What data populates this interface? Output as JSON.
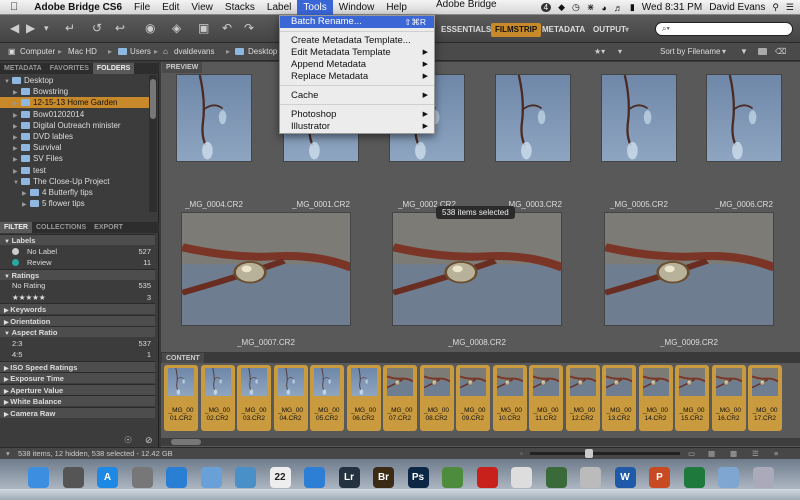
{
  "menubar": {
    "apple": "",
    "app_name": "Adobe Bridge CS6",
    "items": [
      "File",
      "Edit",
      "View",
      "Stacks",
      "Label",
      "Tools",
      "Window",
      "Help"
    ],
    "status_badge": "4",
    "clock": "Wed 8:31 PM",
    "user": "David Evans"
  },
  "toolbar": {
    "window_title_fragment": "Adobe Bridge",
    "workspaces": [
      "ESSENTIALS",
      "FILMSTRIP",
      "METADATA",
      "OUTPUT"
    ],
    "active_workspace": "FILMSTRIP",
    "search_placeholder": "⌕▾"
  },
  "pathbar": {
    "crumbs": [
      "Computer",
      "Mac HD",
      "Users",
      "dvaldevans",
      "Desktop"
    ],
    "sort_label": "Sort by Filename"
  },
  "tools_menu": {
    "items": [
      {
        "label": "Batch Rename...",
        "shortcut": "⇧⌘R",
        "submenu": false
      },
      {
        "label": "Create Metadata Template...",
        "shortcut": "",
        "submenu": false
      },
      {
        "label": "Edit Metadata Template",
        "shortcut": "",
        "submenu": true
      },
      {
        "label": "Append Metadata",
        "shortcut": "",
        "submenu": true
      },
      {
        "label": "Replace Metadata",
        "shortcut": "",
        "submenu": true
      },
      {
        "label": "Cache",
        "shortcut": "",
        "submenu": true
      },
      {
        "label": "Photoshop",
        "shortcut": "",
        "submenu": true
      },
      {
        "label": "Illustrator",
        "shortcut": "",
        "submenu": true
      }
    ]
  },
  "left_panel": {
    "top_tabs": [
      "METADATA",
      "FAVORITES",
      "FOLDERS"
    ],
    "active_top_tab": "FOLDERS",
    "folders": [
      {
        "label": "Desktop",
        "level": 0,
        "expanded": true,
        "selected": false
      },
      {
        "label": "Bowstring",
        "level": 1,
        "expanded": false,
        "selected": false
      },
      {
        "label": "12-15-13 Home Garden",
        "level": 1,
        "expanded": false,
        "selected": true
      },
      {
        "label": "Bow01202014",
        "level": 1,
        "expanded": false,
        "selected": false
      },
      {
        "label": "Digital Outreach minister",
        "level": 1,
        "expanded": false,
        "selected": false
      },
      {
        "label": "DVD lables",
        "level": 1,
        "expanded": false,
        "selected": false
      },
      {
        "label": "Survival",
        "level": 1,
        "expanded": false,
        "selected": false
      },
      {
        "label": "SV Files",
        "level": 1,
        "expanded": false,
        "selected": false
      },
      {
        "label": "test",
        "level": 1,
        "expanded": false,
        "selected": false
      },
      {
        "label": "The Close-Up Project",
        "level": 1,
        "expanded": true,
        "selected": false
      },
      {
        "label": "4 Butterfly tips",
        "level": 2,
        "expanded": false,
        "selected": false
      },
      {
        "label": "5 flower tips",
        "level": 2,
        "expanded": false,
        "selected": false
      }
    ],
    "bottom_tabs": [
      "FILTER",
      "COLLECTIONS",
      "EXPORT"
    ],
    "active_bottom_tab": "FILTER",
    "filter": [
      {
        "header": "Labels",
        "items": [
          {
            "label": "No Label",
            "count": "527"
          },
          {
            "label": "Review",
            "count": "11"
          }
        ]
      },
      {
        "header": "Ratings",
        "items": [
          {
            "label": "No Rating",
            "count": "535"
          },
          {
            "label": "★★★★★",
            "count": "3"
          }
        ]
      },
      {
        "header": "Keywords",
        "items": []
      },
      {
        "header": "Orientation",
        "items": []
      },
      {
        "header": "Aspect Ratio",
        "items": [
          {
            "label": "2:3",
            "count": "537"
          },
          {
            "label": "4:5",
            "count": "1"
          }
        ]
      },
      {
        "header": "ISO Speed Ratings",
        "items": []
      },
      {
        "header": "Exposure Time",
        "items": []
      },
      {
        "header": "Aperture Value",
        "items": []
      },
      {
        "header": "White Balance",
        "items": []
      },
      {
        "header": "Camera Raw",
        "items": []
      }
    ]
  },
  "preview": {
    "tab": "PREVIEW",
    "top_row": [
      "_MG_0004.CR2",
      "_MG_0001.CR2",
      "_MG_0002.CR2",
      "_MG_0003.CR2",
      "_MG_0005.CR2",
      "_MG_0006.CR2"
    ],
    "bottom_row": [
      "_MG_0007.CR2",
      "_MG_0008.CR2",
      "_MG_0009.CR2"
    ],
    "tooltip": "538 items selected"
  },
  "content": {
    "tab": "CONTENT",
    "thumbs": [
      {
        "line1": "_MG_00",
        "line2": "01.CR2",
        "kind": "blue"
      },
      {
        "line1": "_MG_00",
        "line2": "02.CR2",
        "kind": "blue"
      },
      {
        "line1": "_MG_00",
        "line2": "03.CR2",
        "kind": "blue"
      },
      {
        "line1": "_MG_00",
        "line2": "04.CR2",
        "kind": "blue"
      },
      {
        "line1": "_MG_00",
        "line2": "05.CR2",
        "kind": "blue"
      },
      {
        "line1": "_MG_00",
        "line2": "06.CR2",
        "kind": "blue"
      },
      {
        "line1": "_MG_00",
        "line2": "07.CR2",
        "kind": "warm"
      },
      {
        "line1": "_MG_00",
        "line2": "08.CR2",
        "kind": "warm"
      },
      {
        "line1": "_MG_00",
        "line2": "09.CR2",
        "kind": "warm"
      },
      {
        "line1": "_MG_00",
        "line2": "10.CR2",
        "kind": "warm"
      },
      {
        "line1": "_MG_00",
        "line2": "11.CR2",
        "kind": "warm"
      },
      {
        "line1": "_MG_00",
        "line2": "12.CR2",
        "kind": "warm"
      },
      {
        "line1": "_MG_00",
        "line2": "13.CR2",
        "kind": "warm"
      },
      {
        "line1": "_MG_00",
        "line2": "14.CR2",
        "kind": "warm"
      },
      {
        "line1": "_MG_00",
        "line2": "15.CR2",
        "kind": "warm"
      },
      {
        "line1": "_MG_00",
        "line2": "16.CR2",
        "kind": "warm"
      },
      {
        "line1": "_MG_00",
        "line2": "17.CR2",
        "kind": "warm"
      }
    ]
  },
  "status": "538 items, 12 hidden, 538 selected - 12.42 GB",
  "dock": {
    "apps": [
      {
        "name": "finder-icon",
        "label": "",
        "color": "#3b8ee0"
      },
      {
        "name": "launchpad-icon",
        "label": "",
        "color": "#555"
      },
      {
        "name": "app-store-icon",
        "label": "A",
        "color": "#1e88e5"
      },
      {
        "name": "system-preferences-icon",
        "label": "",
        "color": "#777"
      },
      {
        "name": "safari-icon",
        "label": "",
        "color": "#2a7fd4"
      },
      {
        "name": "mail-icon",
        "label": "",
        "color": "#6aa0d8"
      },
      {
        "name": "preview-icon",
        "label": "",
        "color": "#4a90c8"
      },
      {
        "name": "calendar-icon",
        "label": "22",
        "color": "#eee"
      },
      {
        "name": "dropbox-icon",
        "label": "",
        "color": "#2d7fd6"
      },
      {
        "name": "lightroom-icon",
        "label": "Lr",
        "color": "#24323f"
      },
      {
        "name": "bridge-icon",
        "label": "Br",
        "color": "#3b2a14"
      },
      {
        "name": "photoshop-icon",
        "label": "Ps",
        "color": "#0b2744"
      },
      {
        "name": "maps-icon",
        "label": "",
        "color": "#4c8c3c"
      },
      {
        "name": "acrobat-icon",
        "label": "",
        "color": "#c8211c"
      },
      {
        "name": "textedit-icon",
        "label": "",
        "color": "#ddd"
      },
      {
        "name": "time-machine-icon",
        "label": "",
        "color": "#3a6a3a"
      },
      {
        "name": "itunes-icon",
        "label": "",
        "color": "#bbb"
      },
      {
        "name": "word-icon",
        "label": "W",
        "color": "#1e5aa8"
      },
      {
        "name": "powerpoint-icon",
        "label": "P",
        "color": "#c84a22"
      },
      {
        "name": "excel-icon",
        "label": "",
        "color": "#1e7a3c"
      },
      {
        "name": "folder-icon",
        "label": "",
        "color": "#7fa6d0"
      },
      {
        "name": "trash-icon",
        "label": "",
        "color": "#aab"
      }
    ]
  },
  "colors": {
    "accent": "#c8892a",
    "menu_highlight": "#3b66d6"
  }
}
